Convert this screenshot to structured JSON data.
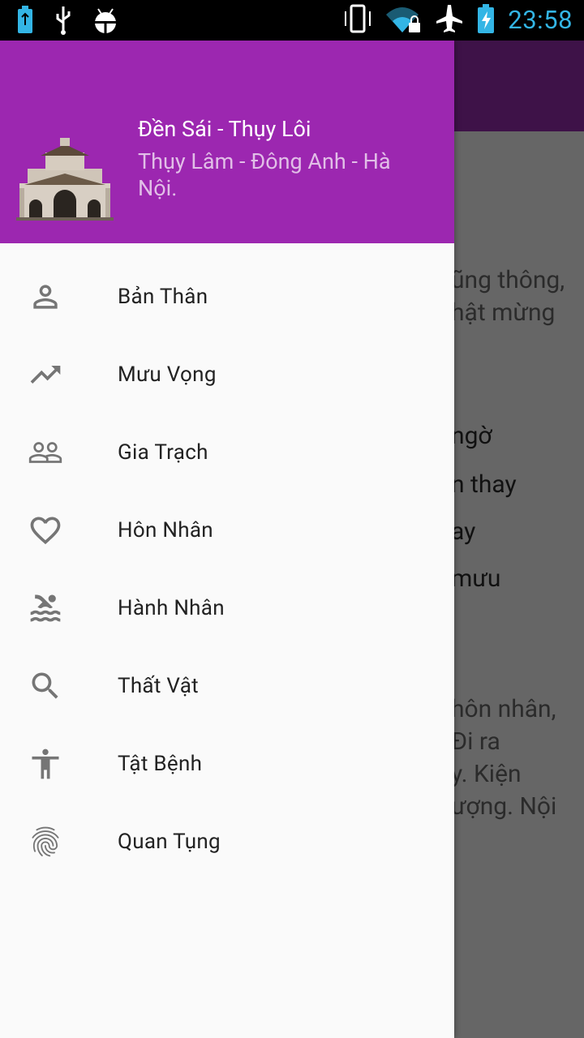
{
  "status_bar": {
    "time": "23:58",
    "icons_left": [
      "battery-charging-icon",
      "usb-icon",
      "android-debug-icon"
    ],
    "icons_right": [
      "vibrate-icon",
      "wifi-lock-icon",
      "airplane-icon",
      "battery-charging-icon"
    ]
  },
  "drawer": {
    "header": {
      "title": "Đền Sái - Thụy Lôi",
      "subtitle": "Thụy Lâm - Đông Anh - Hà Nội.",
      "background_color": "#9c27b0"
    },
    "menu": [
      {
        "label": "Bản Thân",
        "icon": "person-icon"
      },
      {
        "label": "Mưu Vọng",
        "icon": "trending-up-icon"
      },
      {
        "label": "Gia Trạch",
        "icon": "people-icon"
      },
      {
        "label": "Hôn Nhân",
        "icon": "heart-icon"
      },
      {
        "label": "Hành Nhân",
        "icon": "pool-icon"
      },
      {
        "label": "Thất Vật",
        "icon": "search-icon"
      },
      {
        "label": "Tật Bệnh",
        "icon": "accessibility-icon"
      },
      {
        "label": "Quan Tụng",
        "icon": "fingerprint-icon"
      }
    ]
  },
  "background_content": {
    "lines": [
      "ũng thông,",
      "hật mừng",
      "ngờ",
      "n thay",
      "ay",
      "mưu",
      "hôn nhân,",
      "Đi ra",
      "y. Kiện",
      "ượng. Nội"
    ]
  }
}
